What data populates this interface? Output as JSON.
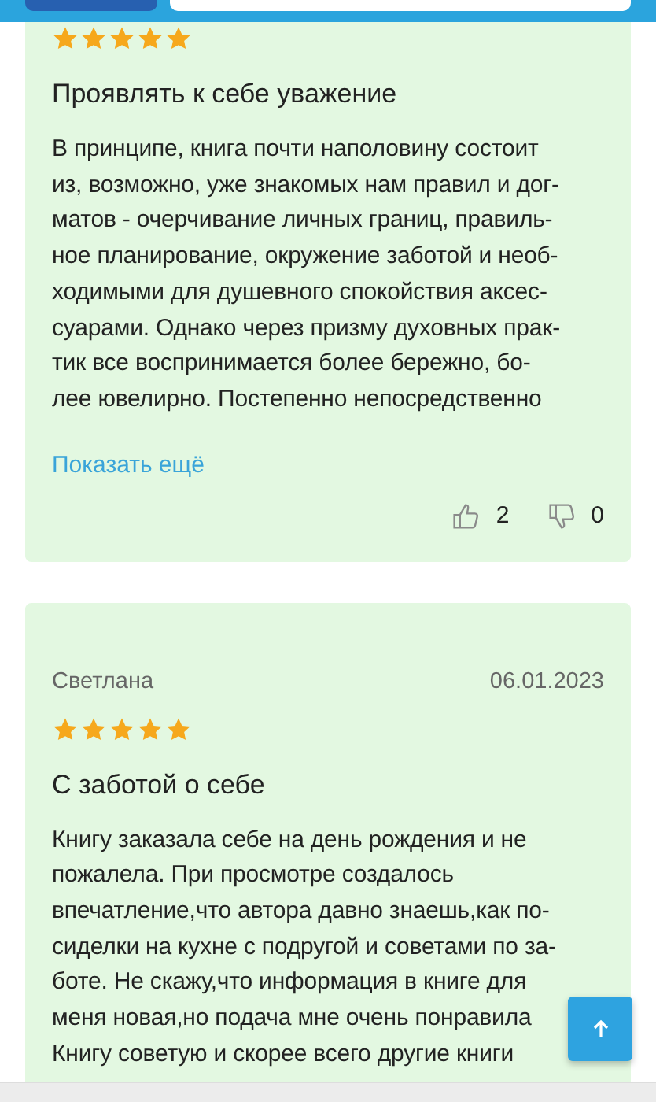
{
  "reviews": [
    {
      "stars": 5,
      "title": "Проявлять к себе уважение",
      "text": "В принципе, книга почти наполовину состоит\nиз, возможно, уже знакомых нам правил и дог-\nматов - очерчивание личных границ, правиль-\nное планирование, окружение заботой и необ-\nходимыми для душевного спокойствия аксес-\nсуарами. Однако через призму духовных прак-\nтик все воспринимается более бережно, бо-\nлее ювелирно. Постепенно непосредственно",
      "more": "Показать ещё",
      "likes": "2",
      "dislikes": "0"
    },
    {
      "author": "Светлана",
      "date": "06.01.2023",
      "stars": 5,
      "title": "С заботой о себе",
      "text": "Книгу заказала себе на день рождения и не\nпожалела. При просмотре создалось\nвпечатление,что автора давно знаешь,как по-\nсиделки на кухне с подругой и советами по за-\nботе. Не скажу,что информация в книге для\nменя новая,но подача мне очень понравила\nКнигу советую и скорее всего другие книги"
    }
  ]
}
